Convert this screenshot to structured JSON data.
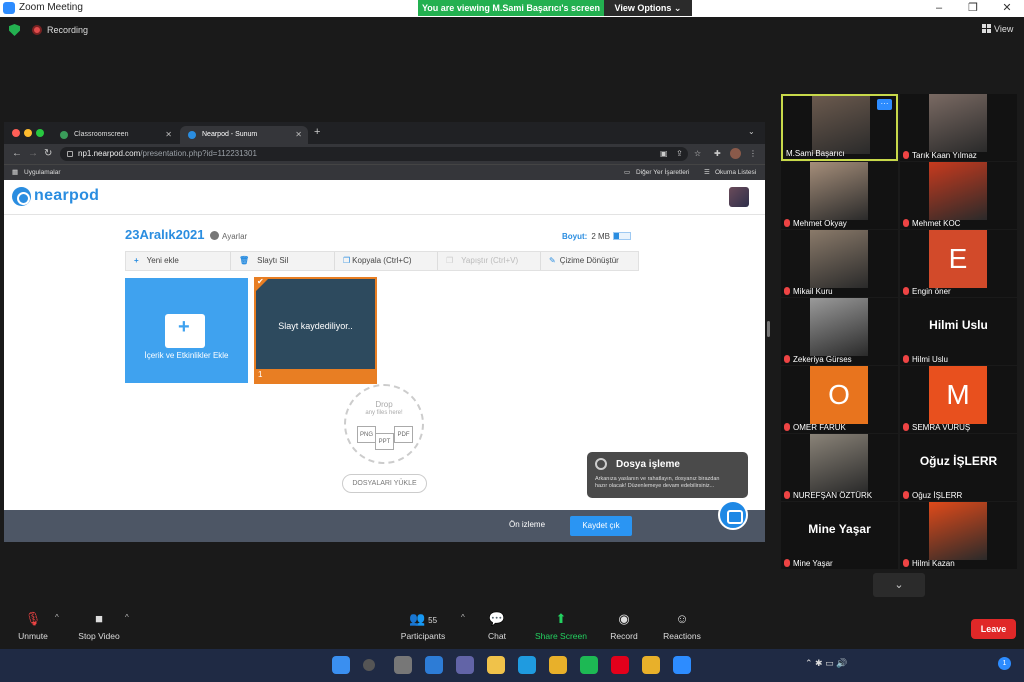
{
  "window": {
    "title": "Zoom Meeting",
    "controls": [
      "–",
      "❐",
      "✕"
    ]
  },
  "banner": {
    "viewing": "You are viewing M.Sami Başarıcı's screen",
    "view_options": "View Options ⌄"
  },
  "topbar": {
    "recording": "Recording",
    "view": "View"
  },
  "browser": {
    "tabs": [
      {
        "label": "Classroomscreen",
        "close": "✕"
      },
      {
        "label": "Nearpod - Sunum",
        "close": "✕"
      }
    ],
    "new_tab": "+",
    "tab_menu": "⌄",
    "nav": {
      "back": "←",
      "forward": "→",
      "reload": "↻"
    },
    "url_host": "np1.nearpod.com",
    "url_path": "/presentation.php?id=112231301",
    "bookmarks": {
      "apps": "Uygulamalar",
      "other": "Diğer Yer İşaretleri",
      "reading": "Okuma Listesi"
    }
  },
  "nearpod": {
    "logo": "nearpod",
    "title": "23Aralık2021",
    "settings": "Ayarlar",
    "size_label": "Boyut:",
    "size_value": "2 MB",
    "toolbar": {
      "add_icon": "+",
      "add": "Yeni ekle",
      "delete_icon": "🗑",
      "delete": "Slaytı Sil",
      "copy_icon": "❐",
      "copy": "Kopyala (Ctrl+C)",
      "paste_icon": "❐",
      "paste": "Yapıştır (Ctrl+V)",
      "convert_icon": "✎",
      "convert": "Çizime Dönüştür"
    },
    "add_card": {
      "plus": "+",
      "label": "İçerik ve Etkinlikler Ekle"
    },
    "slide": {
      "status": "Slayt kaydediliyor..",
      "number": "1",
      "check": "✔"
    },
    "drop": {
      "title": "Drop",
      "subtitle": "any files here!",
      "types": [
        "PNG",
        "PPT",
        "PDF"
      ]
    },
    "upload": "DOSYALARI YÜKLE",
    "toast": {
      "title": "Dosya işleme",
      "message": "Arkanıza yaslanın ve rahatlayın, dosyanız birazdan hazır olacak! Düzenlemeye devam edebilirsiniz..."
    },
    "footer": {
      "preview": "Ön izleme",
      "save": "Kaydet çık"
    }
  },
  "participants": [
    {
      "name": "M.Sami Başarıcı",
      "kind": "photo",
      "color": "#6b5a4e",
      "muted": false,
      "active": true,
      "more": "···"
    },
    {
      "name": "Tarık Kaan Yılmaz",
      "kind": "photo",
      "color": "#7a6a63",
      "muted": true
    },
    {
      "name": "Mehmet Okyay",
      "kind": "photo",
      "color": "#a58e7a",
      "muted": true
    },
    {
      "name": "Mehmet KOC",
      "kind": "photo",
      "color": "#c83a1e",
      "muted": true
    },
    {
      "name": "Mikail Kuru",
      "kind": "photo",
      "color": "#8a7a6a",
      "muted": true
    },
    {
      "name": "Engin öner",
      "kind": "letter",
      "letter": "E",
      "color": "#d24a2a",
      "muted": true
    },
    {
      "name": "Zekeriya Gürses",
      "kind": "photo",
      "color": "#9a9a9a",
      "muted": true
    },
    {
      "name": "Hilmi Uslu",
      "kind": "text",
      "bigname": "Hilmi Uslu",
      "muted": true
    },
    {
      "name": "OMER FARUK",
      "kind": "letter",
      "letter": "O",
      "color": "#e8741e",
      "muted": true
    },
    {
      "name": "SEMRA VURUŞ",
      "kind": "letter",
      "letter": "M",
      "color": "#e8501e",
      "muted": true
    },
    {
      "name": "NUREFŞAN ÖZTÜRK",
      "kind": "photo",
      "color": "#8a8378",
      "muted": true
    },
    {
      "name": "Oğuz İŞLERR",
      "kind": "text",
      "bigname": "Oğuz İŞLERR",
      "muted": true
    },
    {
      "name": "Mine Yaşar",
      "kind": "text",
      "bigname": "Mine Yaşar",
      "muted": true
    },
    {
      "name": "Hilmi Kazan",
      "kind": "photo",
      "color": "#e04a1a",
      "muted": true
    }
  ],
  "gallery_next": "⌄",
  "toolbar": {
    "unmute": "Unmute",
    "stop_video": "Stop Video",
    "participants": "Participants",
    "participants_count": "55",
    "chat": "Chat",
    "share_screen": "Share Screen",
    "record": "Record",
    "reactions": "Reactions",
    "leave": "Leave",
    "caret": "^"
  },
  "taskbar": {
    "apps": [
      {
        "icon": "windows-start",
        "color": "#3a8ff0"
      },
      {
        "icon": "search",
        "color": "#555"
      },
      {
        "icon": "task-view",
        "color": "#777"
      },
      {
        "icon": "widgets",
        "color": "#2d7cd6"
      },
      {
        "icon": "teams-chat",
        "color": "#6264a7"
      },
      {
        "icon": "file-explorer",
        "color": "#f0c24a"
      },
      {
        "icon": "edge",
        "color": "#1f9be0"
      },
      {
        "icon": "chrome",
        "color": "#e8b02a"
      },
      {
        "icon": "spotify",
        "color": "#1db954"
      },
      {
        "icon": "opera",
        "color": "#e3001b"
      },
      {
        "icon": "chrome-2",
        "color": "#e8b02a"
      },
      {
        "icon": "zoom",
        "color": "#2d8cff"
      }
    ],
    "tray": "⌃  ✱  ▭  🔊",
    "notifications": "1"
  }
}
